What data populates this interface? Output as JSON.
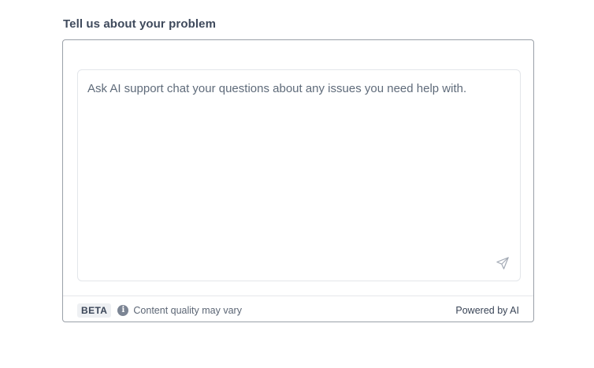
{
  "form": {
    "heading": "Tell us about your problem"
  },
  "chat": {
    "placeholder": "Ask AI support chat your questions about any issues you need help with.",
    "value": ""
  },
  "footer": {
    "badge": "BETA",
    "info_icon": "i",
    "quality_note": "Content quality may vary",
    "powered_by": "Powered by AI"
  },
  "icons": {
    "send": "send-icon",
    "info": "info-icon"
  },
  "colors": {
    "heading": "#3f4a5c",
    "panel_border": "#9aa0a8",
    "muted_text": "#5c6675",
    "badge_bg": "#eef0f3"
  }
}
